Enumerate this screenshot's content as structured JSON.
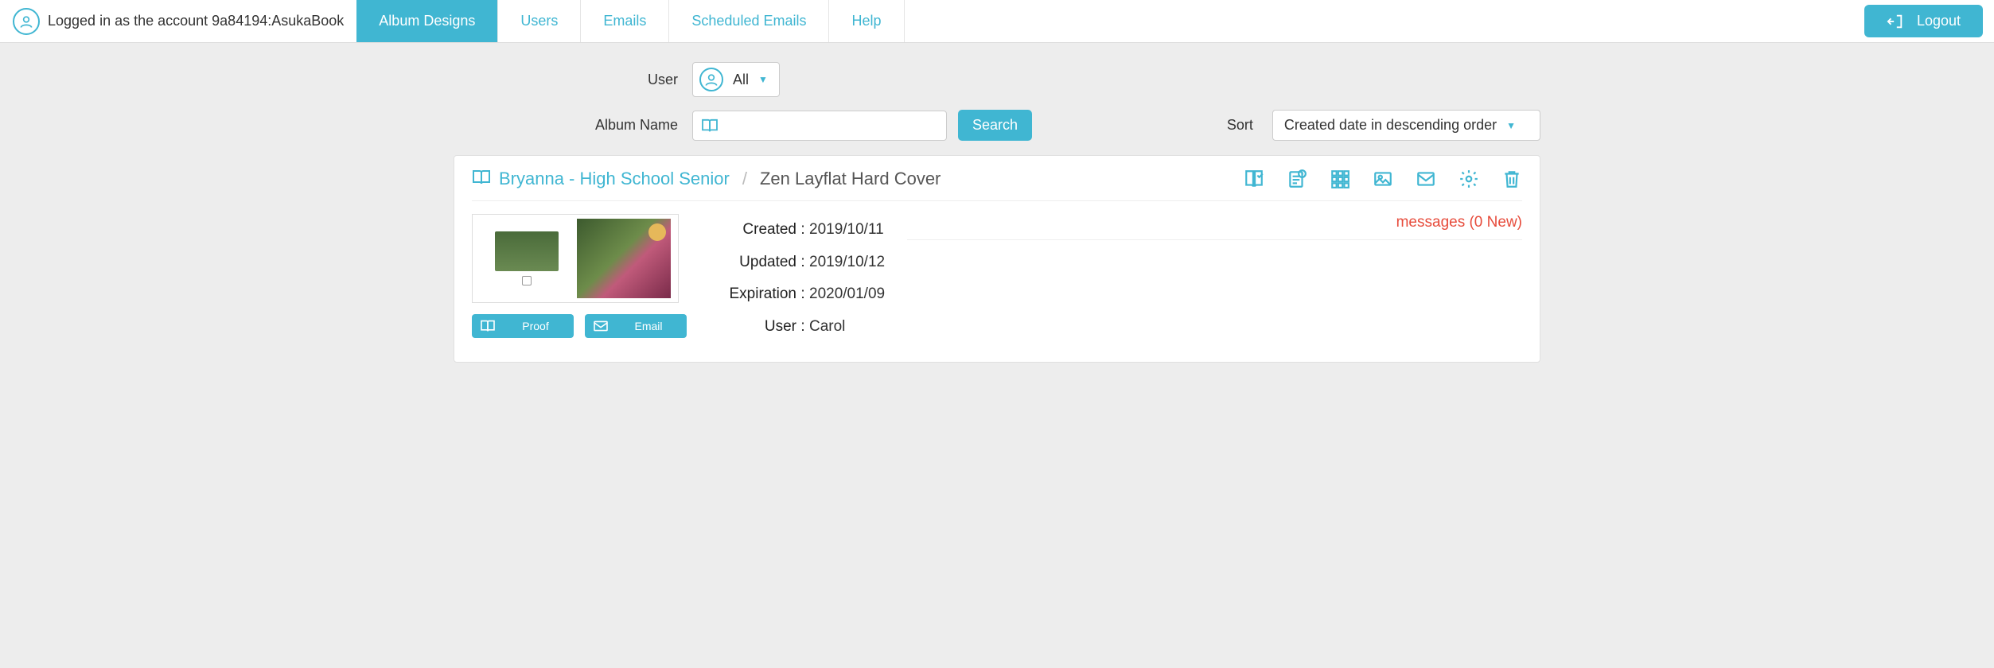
{
  "header": {
    "logged_in_text": "Logged in as the account 9a84194:AsukaBook",
    "tabs": [
      {
        "label": "Album Designs",
        "active": true
      },
      {
        "label": "Users",
        "active": false
      },
      {
        "label": "Emails",
        "active": false
      },
      {
        "label": "Scheduled Emails",
        "active": false
      },
      {
        "label": "Help",
        "active": false
      }
    ],
    "logout_label": "Logout"
  },
  "filters": {
    "user_label": "User",
    "user_selected": "All",
    "album_name_label": "Album Name",
    "album_name_value": "",
    "search_label": "Search",
    "sort_label": "Sort",
    "sort_selected": "Created date in descending order"
  },
  "album": {
    "name": "Bryanna - High School Senior",
    "type": "Zen Layflat Hard Cover",
    "actions": [
      "book-check",
      "notes",
      "grid",
      "image",
      "mail",
      "settings",
      "trash"
    ],
    "details": {
      "created_label": "Created",
      "created_value": "2019/10/11",
      "updated_label": "Updated",
      "updated_value": "2019/10/12",
      "expiration_label": "Expiration",
      "expiration_value": "2020/01/09",
      "user_label": "User",
      "user_value": "Carol"
    },
    "proof_label": "Proof",
    "email_label": "Email",
    "messages_text": "messages (0 New)"
  }
}
